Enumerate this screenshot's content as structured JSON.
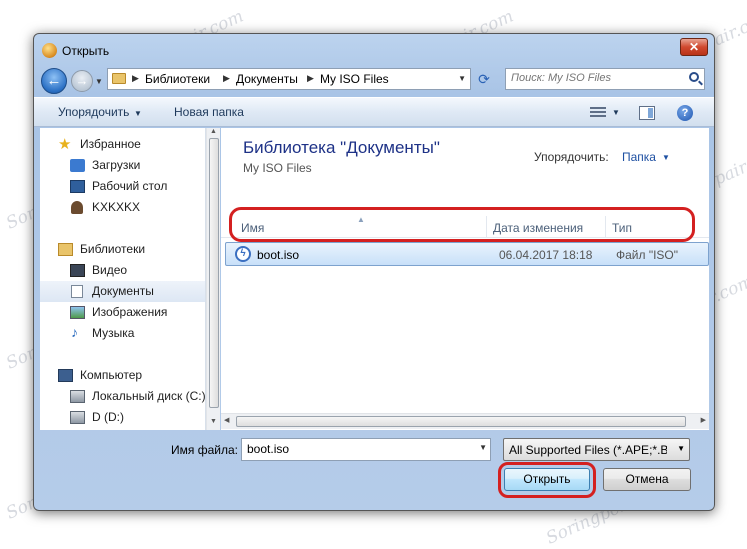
{
  "window": {
    "title": "Открыть"
  },
  "address": {
    "segments": [
      "Библиотеки",
      "Документы",
      "My ISO Files"
    ]
  },
  "search": {
    "placeholder": "Поиск: My ISO Files"
  },
  "toolbar": {
    "organize_label": "Упорядочить",
    "new_folder_label": "Новая папка"
  },
  "nav": {
    "favorites": {
      "label": "Избранное",
      "items": [
        "Загрузки",
        "Рабочий стол",
        "KXKXKX"
      ]
    },
    "libraries": {
      "label": "Библиотеки",
      "items": [
        "Видео",
        "Документы",
        "Изображения",
        "Музыка"
      ]
    },
    "computer": {
      "label": "Компьютер",
      "items": [
        "Локальный диск (C:)",
        "D (D:)"
      ]
    },
    "selected": "Документы"
  },
  "content": {
    "title": "Библиотека \"Документы\"",
    "subtitle": "My ISO Files",
    "arrange_label": "Упорядочить:",
    "arrange_value": "Папка",
    "columns": [
      "Имя",
      "Дата изменения",
      "Тип"
    ],
    "files": [
      {
        "name": "boot.iso",
        "date": "06.04.2017 18:18",
        "type": "Файл \"ISO\""
      }
    ]
  },
  "footer": {
    "filename_label": "Имя файла:",
    "filename_value": "boot.iso",
    "filter_value": "All Supported Files (*.APE;*.BIN",
    "open_label": "Открыть",
    "cancel_label": "Отмена"
  },
  "watermark": "Soringpcrepair.com",
  "colors": {
    "highlight": "#d42020",
    "title_blue": "#1e3287",
    "link_blue": "#1e50a2"
  },
  "icons": [
    "app-icon",
    "back-arrow-icon",
    "forward-arrow-icon",
    "folder-icon",
    "refresh-icon",
    "search-icon",
    "views-icon",
    "preview-pane-icon",
    "help-icon",
    "star-icon",
    "downloads-icon",
    "desktop-icon",
    "user-icon",
    "library-icon",
    "video-icon",
    "document-icon",
    "pictures-icon",
    "music-icon",
    "computer-icon",
    "drive-icon",
    "iso-file-icon"
  ]
}
